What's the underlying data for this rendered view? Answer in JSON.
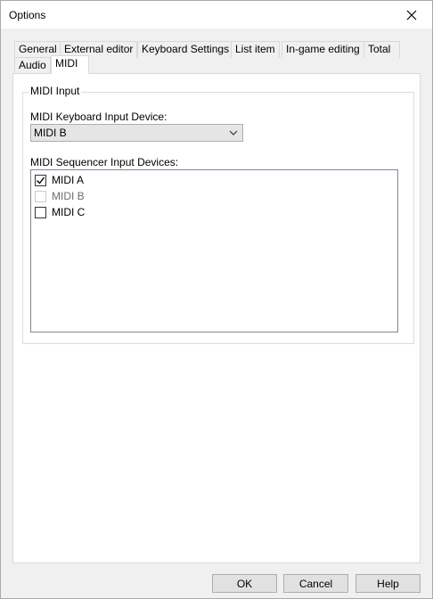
{
  "window": {
    "title": "Options"
  },
  "tabs": [
    {
      "label": "General"
    },
    {
      "label": "External editor"
    },
    {
      "label": "Keyboard Settings"
    },
    {
      "label": "List item"
    },
    {
      "label": "In-game editing"
    },
    {
      "label": "Total"
    },
    {
      "label": "Audio"
    },
    {
      "label": "MIDI"
    }
  ],
  "midi": {
    "group_label": "MIDI Input",
    "keyboard_label": "MIDI Keyboard Input Device:",
    "keyboard_value": "MIDI B",
    "sequencer_label": "MIDI Sequencer Input Devices:",
    "devices": [
      {
        "label": "MIDI A",
        "checked": true,
        "enabled": true
      },
      {
        "label": "MIDI B",
        "checked": false,
        "enabled": false
      },
      {
        "label": "MIDI C",
        "checked": false,
        "enabled": true
      }
    ]
  },
  "buttons": {
    "ok": "OK",
    "cancel": "Cancel",
    "help": "Help"
  }
}
